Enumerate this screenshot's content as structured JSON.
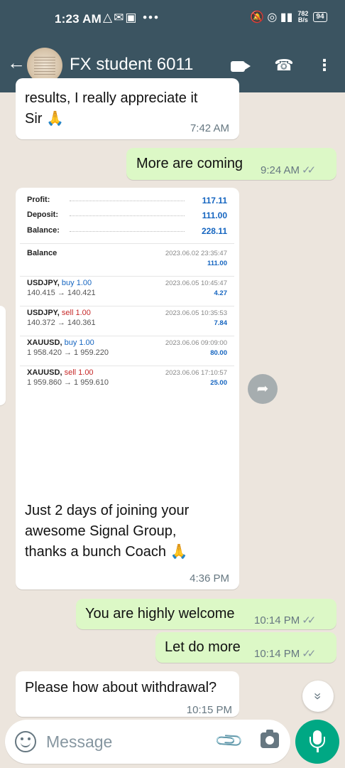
{
  "status_bar": {
    "time": "1:23 AM",
    "left_icons": "△✉▣ •••",
    "right_icons": "🔕 ◎ ▮▮",
    "netspeed_value": "782",
    "netspeed_unit": "B/s",
    "battery": "94"
  },
  "header": {
    "back_glyph": "←",
    "contact_name": "FX student 6011",
    "phone_glyph": "☎",
    "more_glyph": "⋮"
  },
  "messages": [
    {
      "dir": "in",
      "lines": [
        "results, I really appreciate it",
        "Sir 🙏"
      ],
      "time": "7:42 AM"
    },
    {
      "dir": "out",
      "text": "More are coming",
      "time": "9:24 AM"
    },
    {
      "dir": "in",
      "text": "Just 2 days of joining your awesome Signal Group, thanks a bunch Coach 🙏",
      "lines": [
        "Just 2 days of joining your",
        "awesome Signal Group,",
        "thanks a bunch Coach 🙏"
      ],
      "time": "4:36 PM"
    },
    {
      "dir": "out",
      "text": "You are highly welcome",
      "time": "10:14 PM"
    },
    {
      "dir": "out",
      "text": "Let do more",
      "time": "10:14 PM"
    },
    {
      "dir": "in",
      "text": "Please how about withdrawal?",
      "time": "10:15 PM"
    }
  ],
  "ticks_glyph": "✓✓",
  "trade_summary": {
    "profit_label": "Profit:",
    "profit": "117.11",
    "deposit_label": "Deposit:",
    "deposit": "111.00",
    "balance_label": "Balance:",
    "balance": "228.11"
  },
  "trade_rows": [
    {
      "symbol": "Balance",
      "side": "",
      "prices": "",
      "date": "2023.06.02 23:35:47",
      "profit": "111.00"
    },
    {
      "symbol": "USDJPY,",
      "side": "buy 1.00",
      "side_type": "buy",
      "prices": "140.415 → 140.421",
      "date": "2023.06.05 10:45:47",
      "profit": "4.27"
    },
    {
      "symbol": "USDJPY,",
      "side": "sell 1.00",
      "side_type": "sell",
      "prices": "140.372 → 140.361",
      "date": "2023.06.05 10:35:53",
      "profit": "7.84"
    },
    {
      "symbol": "XAUUSD,",
      "side": "buy 1.00",
      "side_type": "buy",
      "prices": "1 958.420 → 1 959.220",
      "date": "2023.06.06 09:09:00",
      "profit": "80.00"
    },
    {
      "symbol": "XAUUSD,",
      "side": "sell 1.00",
      "side_type": "sell",
      "prices": "1 959.860 → 1 959.610",
      "date": "2023.06.06 17:10:57",
      "profit": "25.00"
    }
  ],
  "forward_glyph": "➦",
  "scroll_glyph": "»",
  "input": {
    "placeholder": "Message",
    "value": ""
  },
  "attach_glyph": "📎"
}
